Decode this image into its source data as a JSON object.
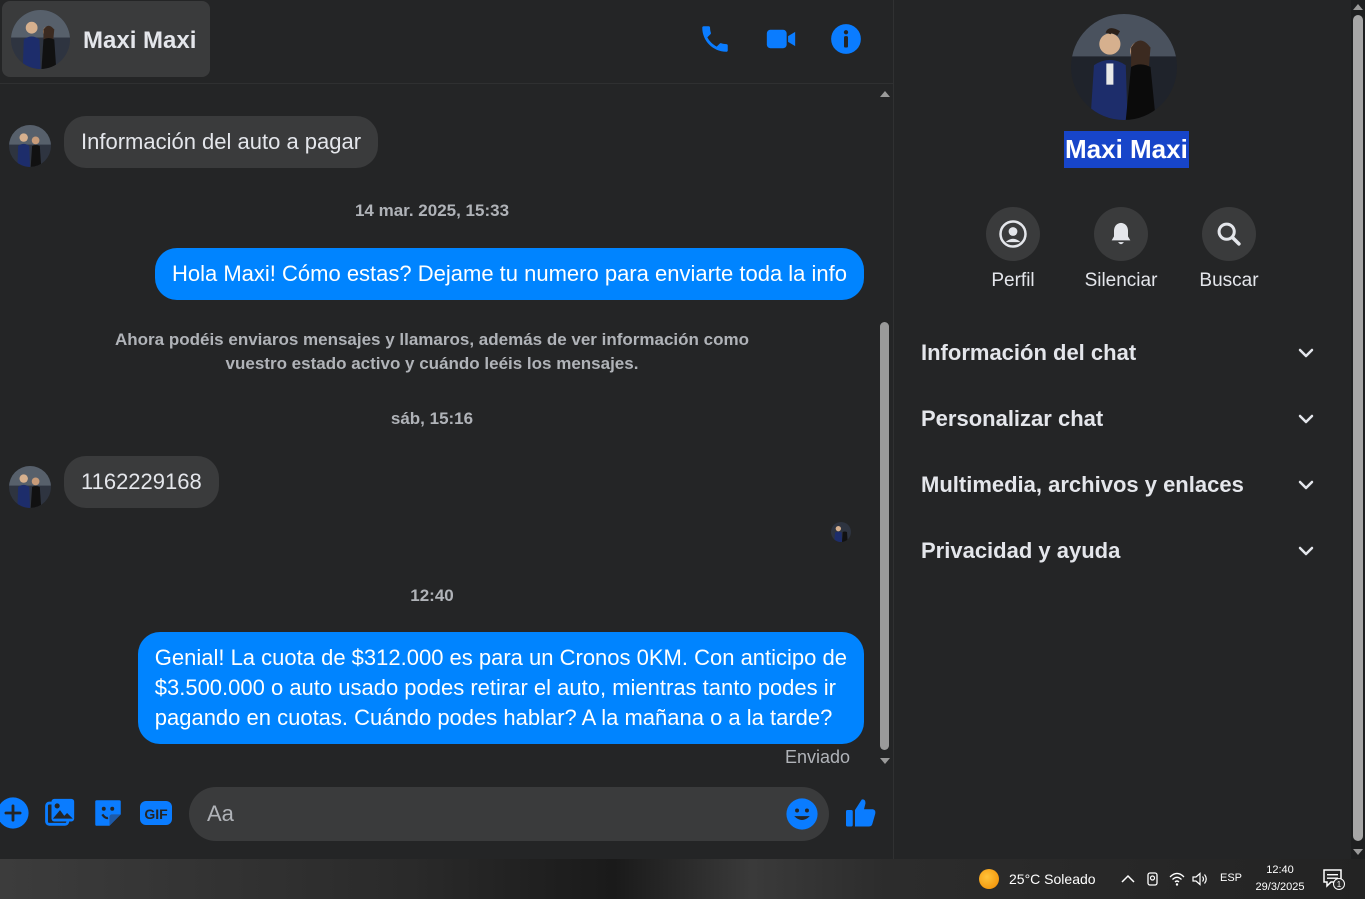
{
  "header": {
    "contact_name": "Maxi Maxi"
  },
  "messages": {
    "incoming_1": "Información del auto a pagar",
    "timestamp_1": "14 mar. 2025, 15:33",
    "outgoing_1": "Hola Maxi! Cómo estas? Dejame tu numero para enviarte toda la info",
    "notice_line_1": "Ahora podéis enviaros mensajes y llamaros, además de ver información como",
    "notice_line_2": "vuestro estado activo y cuándo leéis los mensajes.",
    "timestamp_2": "sáb, 15:16",
    "incoming_2": "1162229168",
    "timestamp_3": "12:40",
    "outgoing_2_line_1": "Genial! La cuota de $312.000 es para un Cronos 0KM. Con anticipo de",
    "outgoing_2_line_2": "$3.500.000 o auto usado podes retirar el auto, mientras tanto podes ir",
    "outgoing_2_line_3": "pagando en cuotas. Cuándo podes hablar? A la mañana o a la tarde?",
    "status": "Enviado"
  },
  "composer": {
    "placeholder": "Aa",
    "gif_label": "GIF"
  },
  "info_panel": {
    "name": "Maxi Maxi",
    "actions": [
      {
        "label": "Perfil",
        "icon": "profile-icon"
      },
      {
        "label": "Silenciar",
        "icon": "bell-icon"
      },
      {
        "label": "Buscar",
        "icon": "search-icon"
      }
    ],
    "sections": [
      "Información del chat",
      "Personalizar chat",
      "Multimedia, archivos y enlaces",
      "Privacidad y ayuda"
    ]
  },
  "taskbar": {
    "weather": "25°C  Soleado",
    "language": "ESP",
    "time": "12:40",
    "date": "29/3/2025",
    "notification_count": "1"
  },
  "colors": {
    "accent": "#0084ff",
    "background": "#242526",
    "bubble_incoming": "#3a3b3c",
    "text_secondary": "#b0b3b8",
    "selection": "#1745c9"
  }
}
